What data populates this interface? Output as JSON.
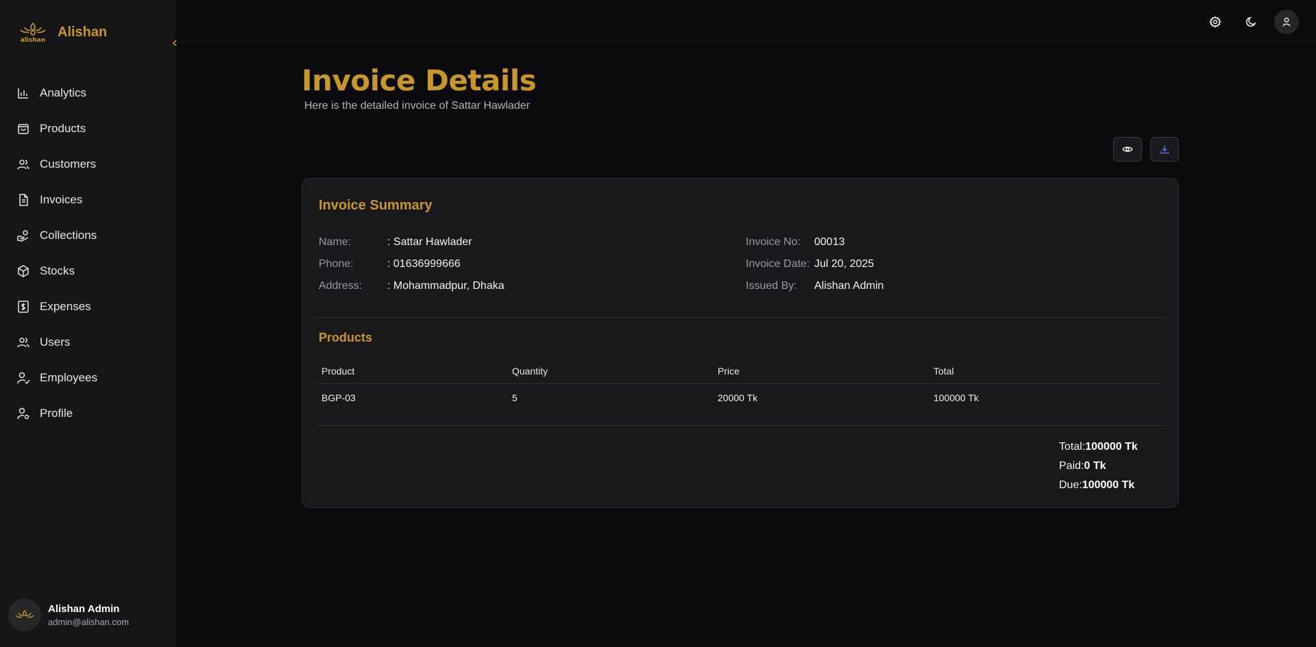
{
  "brand": {
    "name": "Alishan",
    "logo_text": "alishan"
  },
  "sidebar": {
    "collapse_icon": "chevron-left-icon",
    "items": [
      {
        "label": "Analytics",
        "icon": "bar-chart-icon"
      },
      {
        "label": "Products",
        "icon": "shopping-bag-icon"
      },
      {
        "label": "Customers",
        "icon": "users-icon"
      },
      {
        "label": "Invoices",
        "icon": "file-text-icon"
      },
      {
        "label": "Collections",
        "icon": "hand-coins-icon"
      },
      {
        "label": "Stocks",
        "icon": "package-icon"
      },
      {
        "label": "Expenses",
        "icon": "dollar-receipt-icon"
      },
      {
        "label": "Users",
        "icon": "users-icon"
      },
      {
        "label": "Employees",
        "icon": "user-check-icon"
      },
      {
        "label": "Profile",
        "icon": "user-cog-icon"
      }
    ],
    "user": {
      "name": "Alishan Admin",
      "email": "admin@alishan.com"
    }
  },
  "topbar": {
    "icons": [
      "settings-icon",
      "moon-icon",
      "user-icon"
    ]
  },
  "page": {
    "title": "Invoice Details",
    "subtitle": "Here is the detailed invoice of Sattar Hawlader"
  },
  "actions": {
    "view_icon": "eye-icon",
    "download_icon": "download-icon"
  },
  "summary": {
    "title": "Invoice Summary",
    "customer": {
      "name_label": "Name:",
      "name_value": ": Sattar Hawlader",
      "phone_label": "Phone:",
      "phone_value": ": 01636999666",
      "address_label": "Address:",
      "address_value": ": Mohammadpur, Dhaka"
    },
    "invoice": {
      "no_label": "Invoice No:",
      "no_value": "00013",
      "date_label": "Invoice Date:",
      "date_value": "Jul 20, 2025",
      "issued_label": "Issued By:",
      "issued_value": "Alishan Admin"
    }
  },
  "products": {
    "title": "Products",
    "columns": [
      "Product",
      "Quantity",
      "Price",
      "Total"
    ],
    "rows": [
      [
        "BGP-03",
        "5",
        "20000 Tk",
        "100000 Tk"
      ]
    ]
  },
  "totals": {
    "total_label": "Total:",
    "total_value": "100000 Tk",
    "paid_label": "Paid:",
    "paid_value": "0 Tk",
    "due_label": "Due:",
    "due_value": "100000 Tk"
  },
  "colors": {
    "accent": "#c8962e",
    "background": "#0b0b0d",
    "sidebar": "#161618",
    "card": "#19191b"
  }
}
